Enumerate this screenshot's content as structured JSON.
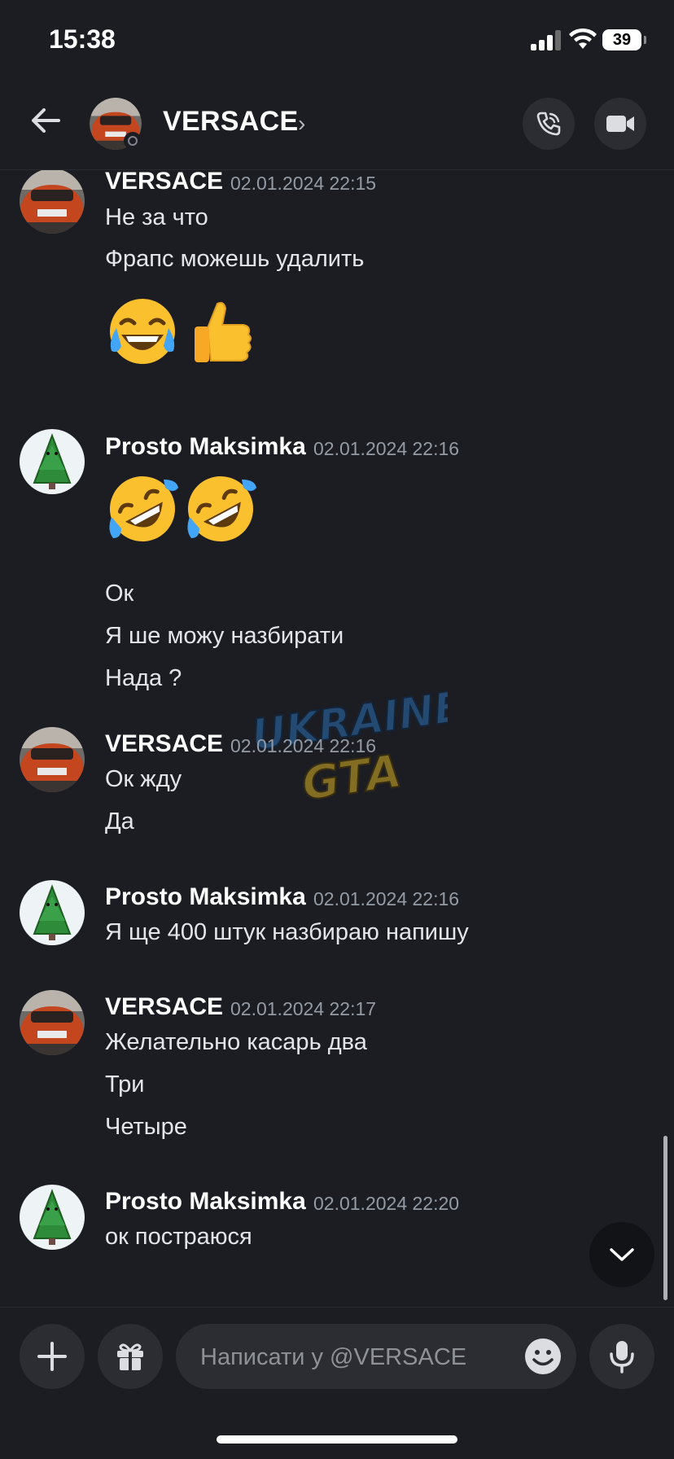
{
  "status_bar": {
    "time": "15:38",
    "battery": "39"
  },
  "header": {
    "name": "VERSACE",
    "chevron": "›"
  },
  "messages": [
    {
      "author": "VERSACE",
      "timestamp": "02.01.2024 22:15",
      "lines": [
        "Не за что",
        "Фрапс можешь удалить"
      ],
      "emoji": [
        "face-with-tears-of-joy",
        "thumbs-up"
      ]
    },
    {
      "author": "Prosto Maksimka",
      "timestamp": "02.01.2024 22:16",
      "emoji": [
        "rolling-on-floor-laughing",
        "rolling-on-floor-laughing"
      ],
      "lines": [
        "Ок",
        "Я ше можу назбирати",
        "Нада ?"
      ]
    },
    {
      "author": "VERSACE",
      "timestamp": "02.01.2024 22:16",
      "lines": [
        "Ок жду",
        "Да"
      ]
    },
    {
      "author": "Prosto Maksimka",
      "timestamp": "02.01.2024 22:16",
      "lines": [
        "Я ще 400 штук назбираю напишу"
      ]
    },
    {
      "author": "VERSACE",
      "timestamp": "02.01.2024 22:17",
      "lines": [
        "Желательно касарь два",
        "Три",
        "Четыре"
      ]
    },
    {
      "author": "Prosto Maksimka",
      "timestamp": "02.01.2024 22:20",
      "lines": [
        "ок постраюся"
      ]
    }
  ],
  "watermark": {
    "line1": "UKRAINE",
    "line2": "GTA"
  },
  "composer": {
    "placeholder": "Написати у @VERSACE"
  },
  "colors": {
    "background": "#1c1d23",
    "surface": "#2b2d33",
    "timestamp": "#949ba4",
    "car_orange": "#c4461f",
    "tree_green": "#2e8b3a"
  },
  "icons": [
    "back-arrow-icon",
    "phone-icon",
    "video-icon",
    "chevron-down-icon",
    "plus-icon",
    "gift-icon",
    "smiley-icon",
    "microphone-icon"
  ]
}
